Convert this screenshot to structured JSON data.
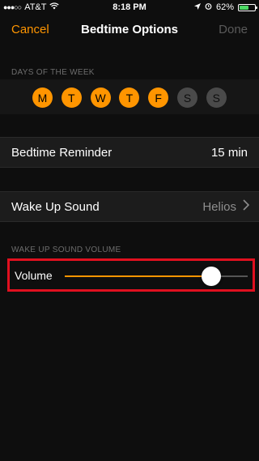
{
  "status_bar": {
    "signal_dots": "●●●○○",
    "carrier": "AT&T",
    "wifi_icon": "wifi-icon",
    "time": "8:18 PM",
    "battery_percent": "62%",
    "battery_level": 0.62
  },
  "nav": {
    "cancel": "Cancel",
    "title": "Bedtime Options",
    "done": "Done"
  },
  "days_section": {
    "header": "DAYS OF THE WEEK",
    "days": [
      {
        "label": "M",
        "selected": true
      },
      {
        "label": "T",
        "selected": true
      },
      {
        "label": "W",
        "selected": true
      },
      {
        "label": "T",
        "selected": true
      },
      {
        "label": "F",
        "selected": true
      },
      {
        "label": "S",
        "selected": false
      },
      {
        "label": "S",
        "selected": false
      }
    ]
  },
  "bedtime_reminder": {
    "label": "Bedtime Reminder",
    "value": "15 min"
  },
  "wake_up_sound": {
    "label": "Wake Up Sound",
    "value": "Helios"
  },
  "volume_section": {
    "header": "WAKE UP SOUND VOLUME",
    "label": "Volume",
    "level": 0.8
  },
  "colors": {
    "accent": "#ff9500",
    "highlight": "#e0101f",
    "background": "#0e0e0e"
  }
}
